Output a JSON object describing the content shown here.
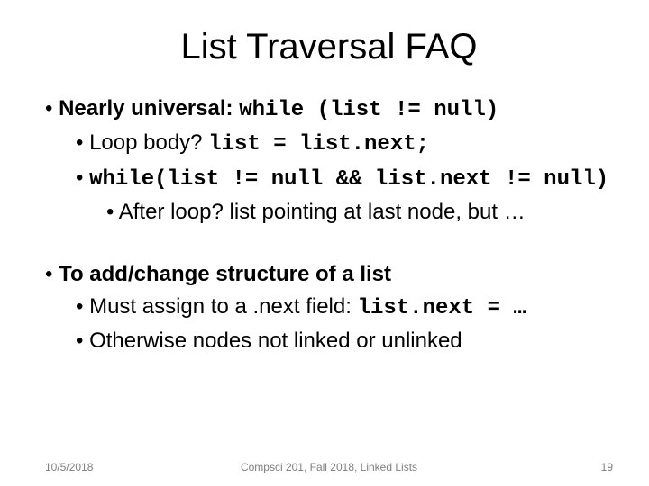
{
  "title": "List Traversal FAQ",
  "bullets": {
    "b1_prefix": "Nearly universal: ",
    "b1_code": "while (list != null)",
    "b1a_prefix": "Loop body? ",
    "b1a_code": "list = list.next;",
    "b1b_code": "while(list != null && list.next != null)",
    "b1b1": "After loop? list pointing at last node, but …",
    "b2": "To add/change structure of a list",
    "b2a_prefix": "Must assign to a .next field:  ",
    "b2a_code": "list.next = …",
    "b2b": "Otherwise nodes not linked or unlinked"
  },
  "footer": {
    "date": "10/5/2018",
    "center": "Compsci 201, Fall 2018, Linked Lists",
    "page": "19"
  }
}
